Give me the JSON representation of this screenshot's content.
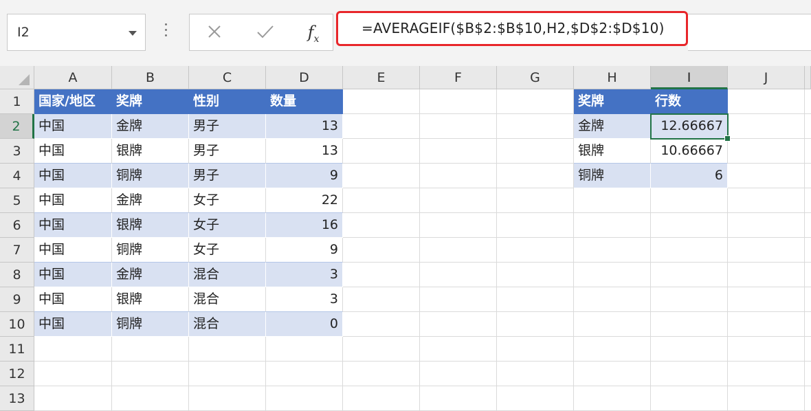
{
  "name_box": {
    "value": "I2"
  },
  "formula_bar": {
    "fx_label": "f",
    "fx_sub": "x",
    "formula": "=AVERAGEIF($B$2:$B$10,H2,$D$2:$D$10)"
  },
  "columns": [
    "A",
    "B",
    "C",
    "D",
    "E",
    "F",
    "G",
    "H",
    "I",
    "J"
  ],
  "rows": [
    "1",
    "2",
    "3",
    "4",
    "5",
    "6",
    "7",
    "8",
    "9",
    "10",
    "11",
    "12",
    "13"
  ],
  "selected_cell": "I2",
  "colors": {
    "table_header": "#4472c4",
    "band": "#d9e1f2",
    "selection": "#217346",
    "formula_highlight": "#e8262a"
  },
  "table1": {
    "headers": [
      "国家/地区",
      "奖牌",
      "性别",
      "数量"
    ],
    "rows": [
      [
        "中国",
        "金牌",
        "男子",
        "13"
      ],
      [
        "中国",
        "银牌",
        "男子",
        "13"
      ],
      [
        "中国",
        "铜牌",
        "男子",
        "9"
      ],
      [
        "中国",
        "金牌",
        "女子",
        "22"
      ],
      [
        "中国",
        "银牌",
        "女子",
        "16"
      ],
      [
        "中国",
        "铜牌",
        "女子",
        "9"
      ],
      [
        "中国",
        "金牌",
        "混合",
        "3"
      ],
      [
        "中国",
        "银牌",
        "混合",
        "3"
      ],
      [
        "中国",
        "铜牌",
        "混合",
        "0"
      ]
    ]
  },
  "table2": {
    "headers": [
      "奖牌",
      "行数"
    ],
    "rows": [
      [
        "金牌",
        "12.66667"
      ],
      [
        "银牌",
        "10.66667"
      ],
      [
        "铜牌",
        "6"
      ]
    ]
  }
}
